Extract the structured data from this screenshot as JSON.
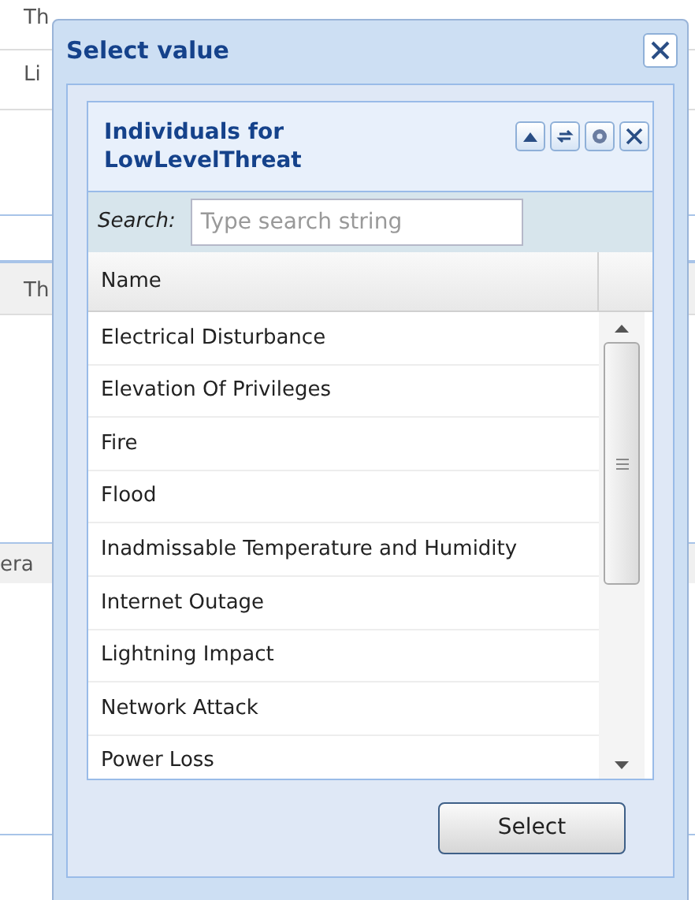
{
  "background": {
    "texts": [
      "Th",
      "Li",
      "Th",
      "era"
    ]
  },
  "dialog": {
    "title": "Select value",
    "panel": {
      "title": "Individuals for LowLevelThreat",
      "search": {
        "label": "Search:",
        "placeholder": "Type search string"
      },
      "column": "Name",
      "rows": [
        {
          "name": "Electrical Disturbance"
        },
        {
          "name": "Elevation Of Privileges"
        },
        {
          "name": "Fire"
        },
        {
          "name": "Flood"
        },
        {
          "name": "Inadmissable Temperature and Humidity"
        },
        {
          "name": "Internet Outage"
        },
        {
          "name": "Lightning Impact"
        },
        {
          "name": "Network Attack"
        },
        {
          "name": "Power Loss"
        }
      ]
    },
    "button": "Select"
  }
}
